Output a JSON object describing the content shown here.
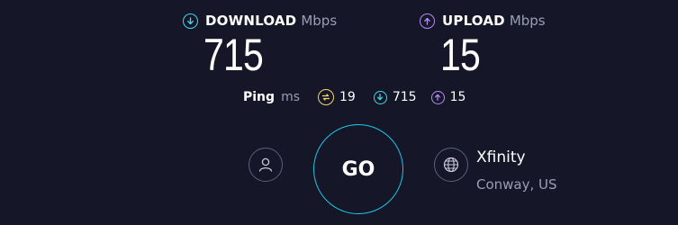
{
  "download": {
    "title": "DOWNLOAD",
    "unit": "Mbps",
    "value": "715",
    "icon": "arrow-down-circle-icon",
    "color": "#3fd8e8"
  },
  "upload": {
    "title": "UPLOAD",
    "unit": "Mbps",
    "value": "15",
    "icon": "arrow-up-circle-icon",
    "color": "#b48cf5"
  },
  "ping": {
    "label": "Ping",
    "unit": "ms",
    "idle": {
      "value": "19",
      "icon": "ping-idle-icon",
      "color": "#f2d46b"
    },
    "download": {
      "value": "715",
      "icon": "arrow-down-circle-icon",
      "color": "#3fd8e8"
    },
    "upload": {
      "value": "15",
      "icon": "arrow-up-circle-icon",
      "color": "#b48cf5"
    }
  },
  "go_button": {
    "label": "GO",
    "color": "#1fc6e4"
  },
  "user": {
    "icon": "user-icon"
  },
  "isp": {
    "name": "Xfinity",
    "location": "Conway, US",
    "icon": "globe-icon"
  }
}
